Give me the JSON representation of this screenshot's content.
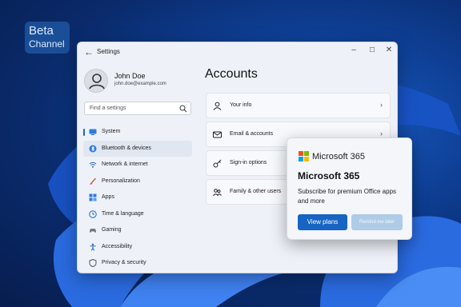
{
  "badge": {
    "line1": "Beta",
    "line2": "Channel"
  },
  "window": {
    "title": "Settings",
    "controls": [
      "–",
      "☐",
      "✕"
    ]
  },
  "user": {
    "name": "John Doe",
    "email": "john.doe@example.com"
  },
  "search": {
    "placeholder": "Find a settings"
  },
  "nav": {
    "items": [
      {
        "label": "System",
        "icon": "system-icon"
      },
      {
        "label": "Bluetooth & devices",
        "icon": "bluetooth-icon"
      },
      {
        "label": "Network & internet",
        "icon": "wifi-icon"
      },
      {
        "label": "Personalization",
        "icon": "brush-icon"
      },
      {
        "label": "Apps",
        "icon": "apps-icon"
      },
      {
        "label": "Time & language",
        "icon": "clock-icon"
      },
      {
        "label": "Gaming",
        "icon": "gamepad-icon"
      },
      {
        "label": "Accessibility",
        "icon": "accessibility-icon"
      },
      {
        "label": "Privacy & security",
        "icon": "shield-icon"
      }
    ],
    "selected": "Bluetooth & devices"
  },
  "main": {
    "heading": "Accounts",
    "cards": [
      {
        "label": "Your info",
        "icon": "person-icon",
        "chevron": "›"
      },
      {
        "label": "Email & accounts",
        "icon": "mail-icon",
        "chevron": "›"
      },
      {
        "label": "Sign-in options",
        "icon": "key-icon"
      },
      {
        "label": "Family & other users",
        "icon": "family-icon"
      }
    ]
  },
  "popup": {
    "brand": "Microsoft 365",
    "title": "Microsoft 365",
    "description": "Subscribe for premium Office apps and more",
    "primary_label": "View plans",
    "secondary_label": "Remind me later"
  },
  "colors": {
    "accent": "#1764c2",
    "desktop": "#0e3f95"
  }
}
